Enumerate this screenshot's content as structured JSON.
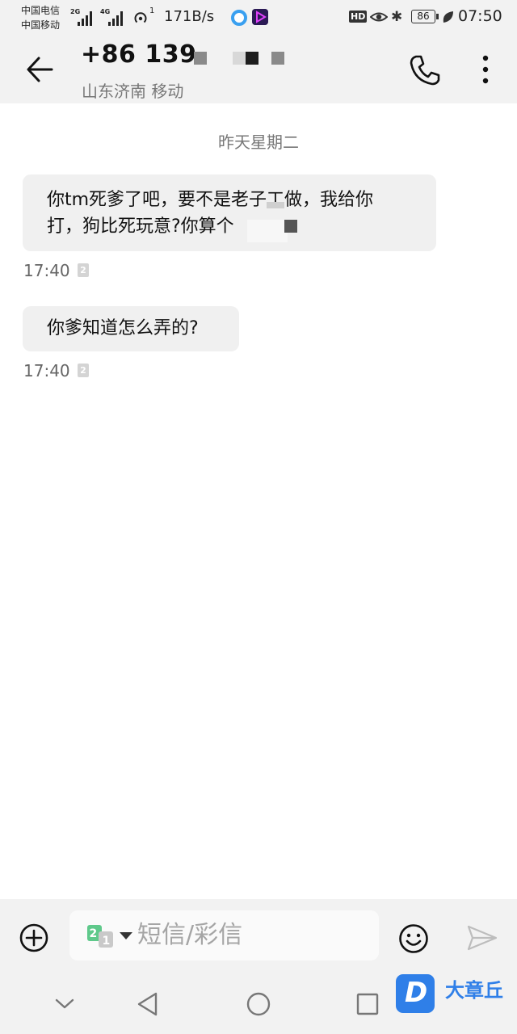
{
  "status_bar": {
    "carrier_1": "中国电信",
    "carrier_2": "中国移动",
    "network_1": "2G",
    "network_2": "4G",
    "hotspot_count": "1",
    "speed": "171B/s",
    "hd": "HD",
    "battery": "86",
    "time": "07:50"
  },
  "header": {
    "contact_number": "+86 139",
    "contact_location": "山东济南 移动"
  },
  "messages": {
    "date_divider": "昨天星期二",
    "items": [
      {
        "text_line1": "你tm死爹了吧，要不是老子工做，我给你",
        "text_line2": "打，狗比死玩意?你算个",
        "time": "17:40",
        "sim": "2"
      },
      {
        "text_line1": "你爹知道怎么弄的?",
        "time": "17:40",
        "sim": "2"
      }
    ]
  },
  "composer": {
    "placeholder": "短信/彩信",
    "sim_primary": "2",
    "sim_secondary": "1"
  },
  "watermark": {
    "letter": "D",
    "brand": "大章丘"
  },
  "colors": {
    "bar_bg": "#f2f2f2",
    "bubble_bg": "#f0f0f0",
    "sim_green": "#5fc98b",
    "brand_blue": "#2f7fe8"
  }
}
